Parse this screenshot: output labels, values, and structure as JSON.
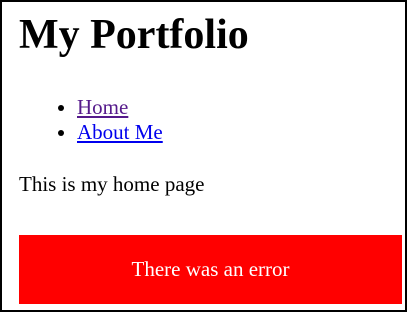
{
  "page": {
    "title": "My Portfolio"
  },
  "nav": {
    "items": [
      {
        "label": "Home",
        "state": "visited",
        "color": "#551a8b"
      },
      {
        "label": "About Me",
        "state": "unvisited",
        "color": "#0000ee"
      }
    ]
  },
  "content": {
    "intro_text": "This is my home page"
  },
  "error": {
    "message": "There was an error",
    "background": "#ff0000",
    "text_color": "#ffffff"
  }
}
